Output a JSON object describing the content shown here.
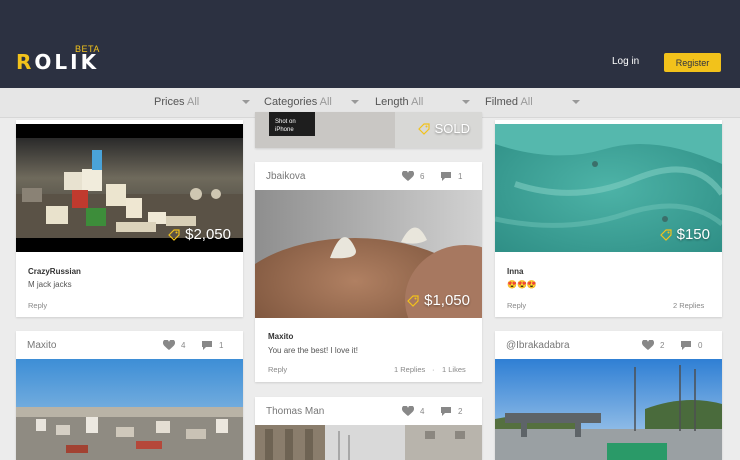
{
  "brand": {
    "logo_first": "R",
    "logo_rest": "OLIK",
    "beta": "BETA"
  },
  "header": {
    "login": "Log in",
    "register": "Register"
  },
  "filters": [
    {
      "label": "Prices",
      "value": "All"
    },
    {
      "label": "Categories",
      "value": "All"
    },
    {
      "label": "Length",
      "value": "All"
    },
    {
      "label": "Filmed",
      "value": "All"
    }
  ],
  "cards": {
    "col1_top": {
      "user": "CrazyRussian",
      "text": "M jack jacks",
      "price": "$2,050",
      "reply": "Reply"
    },
    "col1_bottom": {
      "user": "Maxito",
      "likes": "4",
      "comments": "1"
    },
    "col2_top": {
      "price": "SOLD",
      "sticker": "Shot on iPhone"
    },
    "col2_mid": {
      "user": "Jbaikova",
      "likes": "6",
      "comments": "1",
      "price": "$1,050",
      "comment_user": "Maxito",
      "comment_text": "You are the best! I love it!",
      "reply": "Reply",
      "replies": "1 Replies",
      "likes_text": "1 Likes"
    },
    "col2_bottom": {
      "user": "Thomas Man",
      "likes": "4",
      "comments": "2"
    },
    "col3_top": {
      "price": "$150",
      "user": "Inna",
      "text": "😍😍😍",
      "reply": "Reply",
      "replies": "2 Replies"
    },
    "col3_bottom": {
      "user": "@Ibrakadabra",
      "likes": "2",
      "comments": "0"
    }
  },
  "colors": {
    "header_bg": "#2c3141",
    "accent": "#f2c21b"
  }
}
